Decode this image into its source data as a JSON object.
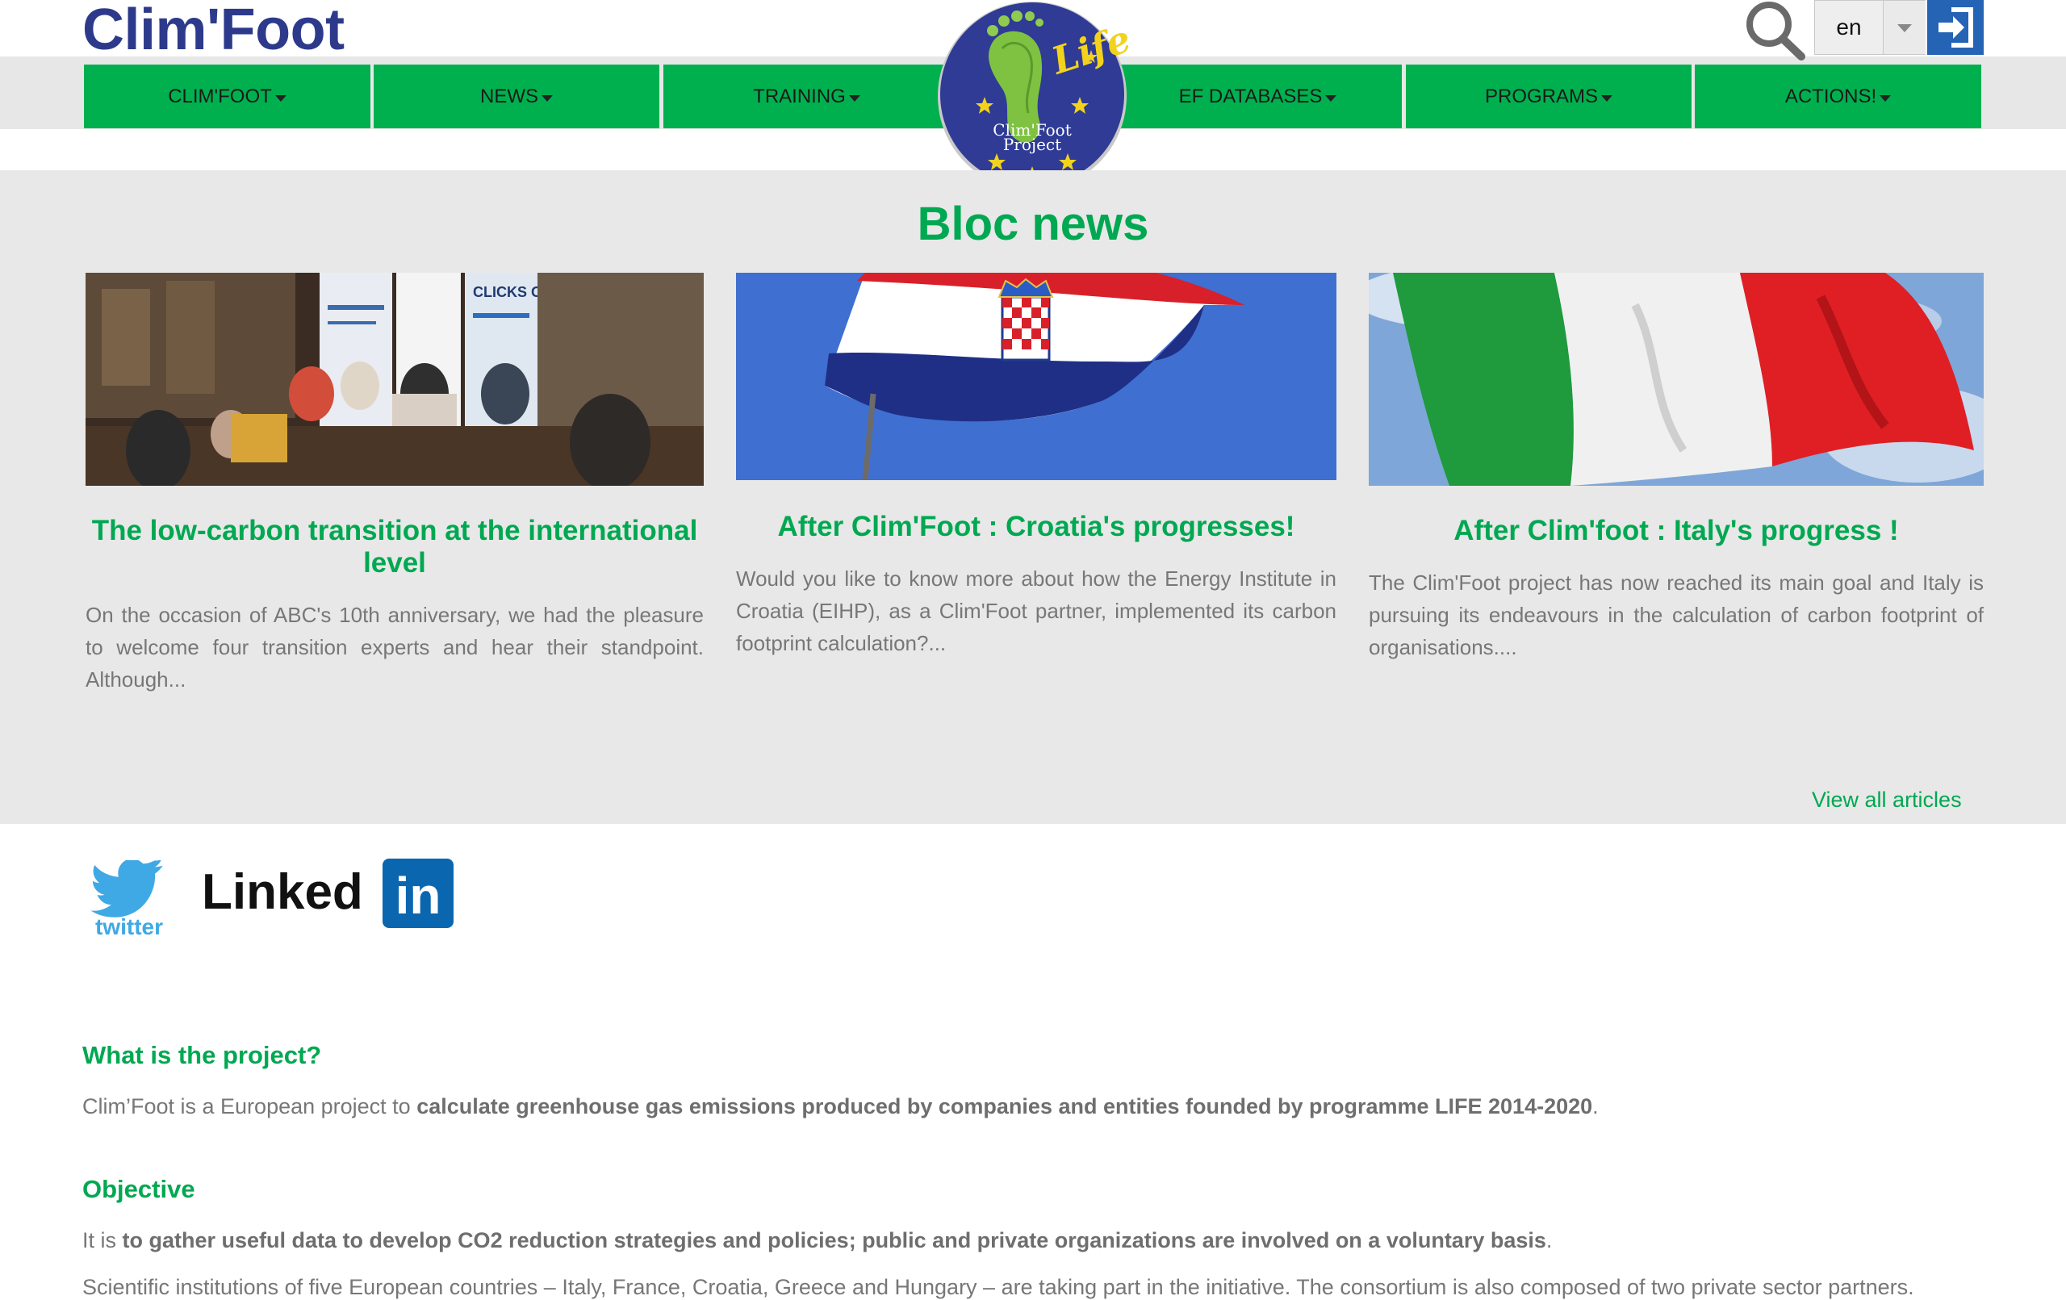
{
  "header": {
    "site_title": "Clim'Foot",
    "language": "en",
    "logo": {
      "ring_text": "Life",
      "center_text_1": "Clim'Foot",
      "center_text_2": "Project"
    }
  },
  "nav": {
    "items": [
      {
        "label": "CLIM'FOOT"
      },
      {
        "label": "NEWS"
      },
      {
        "label": "TRAINING"
      },
      {
        "label": "EF DATABASES"
      },
      {
        "label": "PROGRAMS"
      },
      {
        "label": "ACTIONS!"
      }
    ]
  },
  "news": {
    "title": "Bloc news",
    "cards": [
      {
        "title": "The low-carbon transition at the international level",
        "excerpt": "On the occasion of ABC's 10th anniversary, we had the pleasure to welcome four transition experts and hear their standpoint.  Although...",
        "image_alt": "Conference panel"
      },
      {
        "title": "After Clim'Foot : Croatia's progresses!",
        "excerpt": "Would you like to know more about how the Energy Institute in Croatia (EIHP), as a Clim'Foot partner, implemented its carbon footprint calculation?...",
        "image_alt": "Croatian flag"
      },
      {
        "title": "After Clim'foot : Italy's progress !",
        "excerpt": "The Clim'Foot project has now reached its main goal and Italy is pursuing its endeavours in the calculation of carbon footprint of organisations....",
        "image_alt": "Italian flag"
      }
    ],
    "view_all": "View all articles",
    "banner_text": "CLICKS ON"
  },
  "social": {
    "twitter_label": "twitter",
    "linkedin_label": "Linked",
    "linkedin_badge": "in"
  },
  "about": {
    "q_heading": "What is the project?",
    "q_text_1": "Clim’Foot is a European project to ",
    "q_text_bold": "calculate greenhouse gas emissions produced by companies and entities founded by programme LIFE 2014-2020",
    "q_text_2": ".",
    "obj_heading": "Objective",
    "obj_text_1": "It is ",
    "obj_text_bold": "to gather useful data to develop CO2 reduction strategies and policies; public and private organizations are involved on a voluntary basis",
    "obj_text_2": ".",
    "partial_text": "Scientific institutions of five European countries – Italy, France, Croatia, Greece and Hungary – are taking part in the initiative. The consortium is also composed of two private sector partners."
  },
  "colors": {
    "brand_green": "#00b04f",
    "title_blue": "#2d3a8c",
    "login_blue": "#2563b5"
  }
}
